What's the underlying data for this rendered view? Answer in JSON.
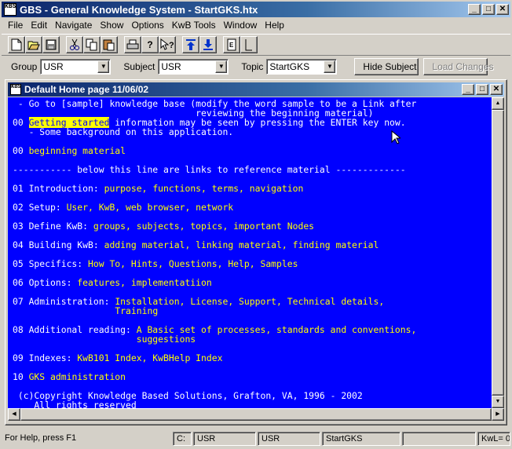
{
  "app": {
    "title": "GBS - General Knowledge System - StartGKS.htx",
    "icon_text": "KBS",
    "caption_buttons": [
      "_",
      "□",
      "X"
    ]
  },
  "menu": [
    "File",
    "Edit",
    "Navigate",
    "Show",
    "Options",
    "KwB Tools",
    "Window",
    "Help"
  ],
  "toolbar": {
    "buttons": [
      "new-icon",
      "open-icon",
      "save-icon",
      "cut-icon",
      "copy-icon",
      "paste-icon",
      "print-icon",
      "help-icon",
      "context-help-icon",
      "up-arrow-icon",
      "down-arrow-icon",
      "page-icon",
      "blank-page-icon"
    ]
  },
  "selectors": {
    "group_label": "Group",
    "group_value": "USR",
    "subject_label": "Subject",
    "subject_value": "USR",
    "topic_label": "Topic",
    "topic_value": "StartGKS",
    "hide_subject": "Hide Subject",
    "load_changes": "Load Changes"
  },
  "child": {
    "title": "Default Home page 11/06/02",
    "lines": [
      [
        {
          "t": " - Go to [sample] knowledge base (modify the word sample to be a Link after",
          "c": "w"
        }
      ],
      [
        {
          "t": "                                  reviewing the beginning material)",
          "c": "w"
        }
      ],
      [
        {
          "t": "00 ",
          "c": "w"
        },
        {
          "t": "Getting started",
          "c": "hl"
        },
        {
          "t": " information may be seen by pressing the ENTER key now.",
          "c": "w"
        }
      ],
      [
        {
          "t": "   - Some background on this application.",
          "c": "w"
        }
      ],
      [
        {
          "t": "",
          "c": "w"
        }
      ],
      [
        {
          "t": "00 ",
          "c": "w"
        },
        {
          "t": "beginning material",
          "c": "y"
        }
      ],
      [
        {
          "t": "",
          "c": "w"
        }
      ],
      [
        {
          "t": "----------- below this line are links to reference material -------------",
          "c": "w"
        }
      ],
      [
        {
          "t": "",
          "c": "w"
        }
      ],
      [
        {
          "t": "01 Introduction: ",
          "c": "w"
        },
        {
          "t": "purpose, functions, terms, navigation",
          "c": "y"
        }
      ],
      [
        {
          "t": "",
          "c": "w"
        }
      ],
      [
        {
          "t": "02 Setup: ",
          "c": "w"
        },
        {
          "t": "User, KwB, web browser, network",
          "c": "y"
        }
      ],
      [
        {
          "t": "",
          "c": "w"
        }
      ],
      [
        {
          "t": "03 Define KwB: ",
          "c": "w"
        },
        {
          "t": "groups, subjects, topics, important Nodes",
          "c": "y"
        }
      ],
      [
        {
          "t": "",
          "c": "w"
        }
      ],
      [
        {
          "t": "04 Building KwB: ",
          "c": "w"
        },
        {
          "t": "adding material, linking material, finding material",
          "c": "y"
        }
      ],
      [
        {
          "t": "",
          "c": "w"
        }
      ],
      [
        {
          "t": "05 Specifics: ",
          "c": "w"
        },
        {
          "t": "How To, Hints, Questions, Help, Samples",
          "c": "y"
        }
      ],
      [
        {
          "t": "",
          "c": "w"
        }
      ],
      [
        {
          "t": "06 Options: ",
          "c": "w"
        },
        {
          "t": "features, implementatiion",
          "c": "y"
        }
      ],
      [
        {
          "t": "",
          "c": "w"
        }
      ],
      [
        {
          "t": "07 Administration: ",
          "c": "w"
        },
        {
          "t": "Installation, License, Support, Technical details,",
          "c": "y"
        }
      ],
      [
        {
          "t": "                   ",
          "c": "w"
        },
        {
          "t": "Training",
          "c": "y"
        }
      ],
      [
        {
          "t": "",
          "c": "w"
        }
      ],
      [
        {
          "t": "08 Additional reading: ",
          "c": "w"
        },
        {
          "t": "A Basic set of processes, standards and conventions,",
          "c": "y"
        }
      ],
      [
        {
          "t": "                       ",
          "c": "w"
        },
        {
          "t": "suggestions",
          "c": "y"
        }
      ],
      [
        {
          "t": "",
          "c": "w"
        }
      ],
      [
        {
          "t": "09 Indexes: ",
          "c": "w"
        },
        {
          "t": "KwB101 Index, KwBHelp Index",
          "c": "y"
        }
      ],
      [
        {
          "t": "",
          "c": "w"
        }
      ],
      [
        {
          "t": "10 ",
          "c": "w"
        },
        {
          "t": "GKS administration",
          "c": "y"
        }
      ],
      [
        {
          "t": "",
          "c": "w"
        }
      ],
      [
        {
          "t": " (c)Copyright Knowledge Based Solutions, Grafton, VA, 1996 - 2002",
          "c": "w"
        }
      ],
      [
        {
          "t": "    All rights reserved",
          "c": "w"
        }
      ]
    ]
  },
  "status": {
    "help": "For Help, press F1",
    "drive": "C:",
    "group": "USR",
    "subject": "USR",
    "topic": "StartGKS",
    "kwl": "KwL= 0"
  },
  "colors": {
    "content_bg": "#0000ff",
    "text": "#ffffff",
    "link": "#ffff00",
    "title_bar": "#0a246a"
  }
}
